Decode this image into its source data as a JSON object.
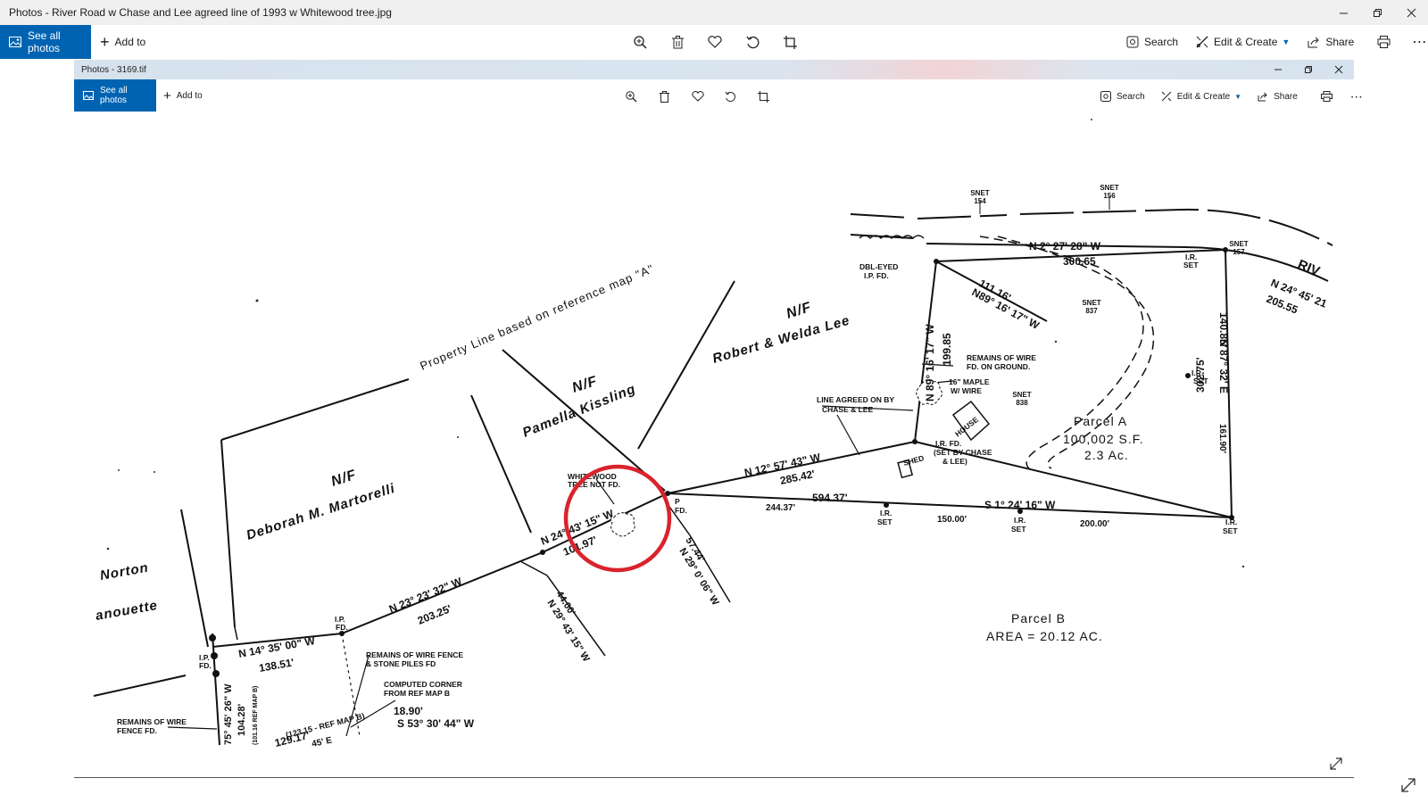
{
  "window": {
    "title": "Photos - River Road w Chase and Lee agreed line of 1993 w Whitewood tree.jpg",
    "controls": [
      "minimize-icon",
      "restore-icon",
      "close-icon"
    ]
  },
  "toolbar": {
    "see_all_label": "See all photos",
    "add_to_label": "Add to",
    "search_label": "Search",
    "edit_create_label": "Edit & Create",
    "share_label": "Share",
    "accent_color": "#0063b1"
  },
  "inner": {
    "title": "Photos - 3169.tif",
    "see_all_label": "See all photos",
    "add_to_label": "Add to",
    "search_label": "Search",
    "edit_create_label": "Edit & Create",
    "share_label": "Share"
  },
  "map": {
    "owners": {
      "norton_1": "Norton",
      "norton_2": "anouette",
      "martorelli_nf": "N/F",
      "martorelli": "Deborah   M. Martorelli",
      "kissling_nf": "N/F",
      "kissling": "Pamella Kissling",
      "lee_nf": "N/F",
      "lee": "Robert & Welda Lee"
    },
    "property_line": "Property Line based on reference map \"A\"",
    "snet": {
      "s154a": "SNET",
      "s154b": "154",
      "s156a": "SNET",
      "s156b": "156",
      "s157a": "SNET",
      "s157b": "157",
      "s837a": "SNET",
      "s837b": "837",
      "s838a": "SNET",
      "s838b": "838"
    },
    "bearings": {
      "n2": "N 2°  27'  28\" W",
      "d30065": "300.65",
      "n24_45": "N 24° 45' 21",
      "d20555": "205.55",
      "riv": "RIV",
      "d11116": "111.16'",
      "n89_16_w_diag": "N89° 16' 17\" W",
      "n89_vert": "N 89° 16' 17\" W",
      "d19985": "199.85",
      "d14085": "140.85'",
      "n87": "N 87° 32' E",
      "d30275": "302.75'",
      "d16190": "161.90'",
      "n12": "N  12°  57'  43\"  W",
      "d28542": "285.42'",
      "d59437": "594.37'",
      "s1": "S  1°  24'  16\"    W",
      "d24437": "244.37'",
      "d15000": "150.00'",
      "d20000": "200.00'",
      "n24_43": "N 24° 43' 15\" W",
      "d10197": "101.97'",
      "d5744": "57.44'",
      "n29_0": "N 29°  0' 06\" W",
      "n23": "N  23°  23'  32\"  W",
      "d20325": "203.25'",
      "d4400": "44.00'",
      "n29_43": "N 29° 43' 15\" W",
      "n14": "N  14°  35'  00\"  W",
      "d13851": "138.51'",
      "s75": "75° 45' 26\" W",
      "d10428": "104.28'",
      "ref": "(101.16 REF MAP B)",
      "ref2": "(123.15 - REF MAP B)",
      "d12917": "129.17'",
      "d1890": "18.90'",
      "s53": "S 53° 30' 44\" W",
      "e_frag": "45' E"
    },
    "notes": {
      "dbl_1": "DBL-EYED",
      "dbl_2": "I.P. FD.",
      "wire_1": "REMAINS OF WIRE",
      "wire_2": "FD. ON GROUND.",
      "maple_1": "16\" MAPLE",
      "maple_2": "W/ WIRE",
      "agreed_1": "LINE AGREED ON BY",
      "agreed_2": "CHASE  & LEE",
      "irfd_1": "I.R. FD.",
      "irfd_2": "(SET BY CHASE",
      "irfd_3": "& LEE)",
      "house": "HOUSE",
      "shed": "SHED",
      "parcel_a": "Parcel  A",
      "parcel_a_area": "100,002 S.F.",
      "parcel_a_ac": "2.3  Ac.",
      "parcel_b": "Parcel  B",
      "parcel_b_area": "AREA = 20.12  AC.",
      "whitewood_1": "WHITEWOOD",
      "whitewood_2": "TREE NOT FD.",
      "ir_set": "I.R.",
      "set": "SET",
      "ip_a": "I.P.",
      "ip_b": "FD.",
      "p_a": "P",
      "p_b": "FD.",
      "fence_1": "REMAINS OF WIRE FENCE",
      "fence_2": "& STONE PILES FD",
      "corner_1": "COMPUTED CORNER",
      "corner_2": "FROM REF MAP B",
      "rem_1": "REMAINS OF WIRE",
      "rem_2": "FENCE FD."
    },
    "highlight_color": "#d9232d"
  }
}
